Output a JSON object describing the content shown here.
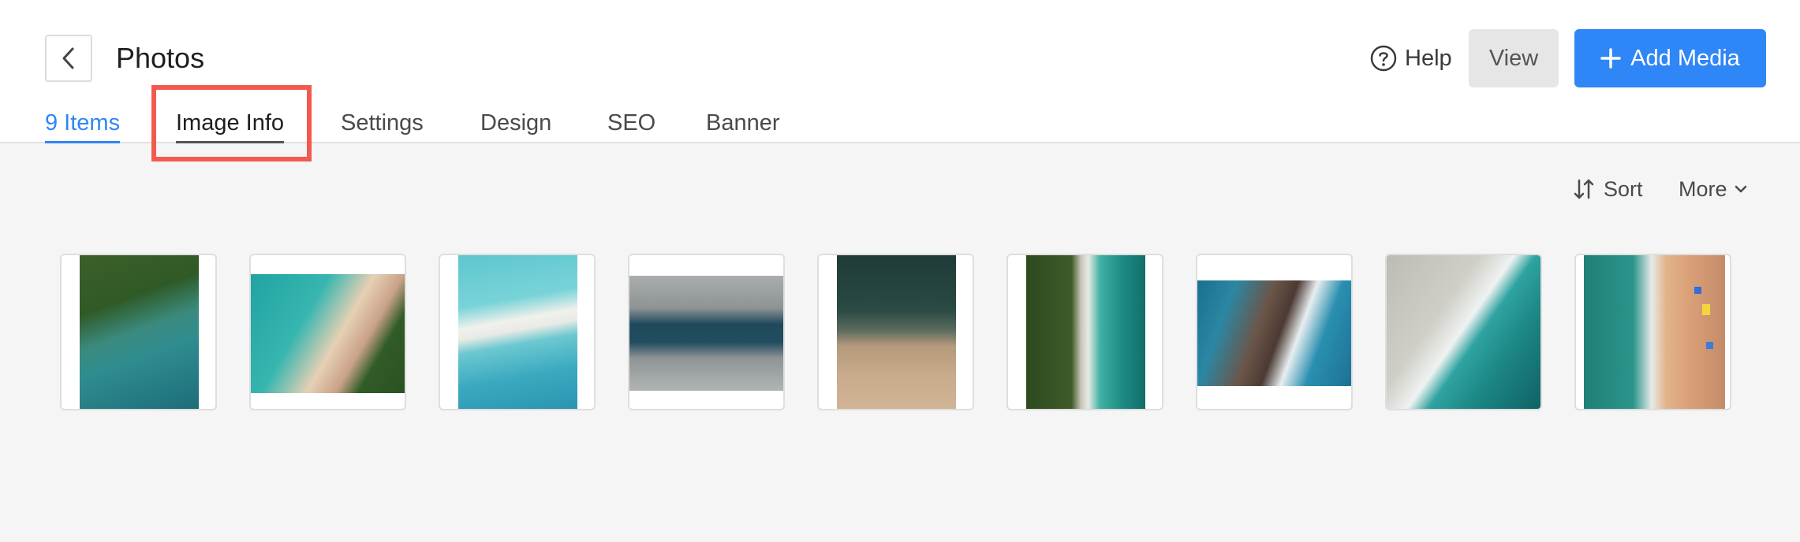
{
  "header": {
    "title": "Photos",
    "help_label": "Help",
    "view_label": "View",
    "add_media_label": "Add Media"
  },
  "tabs": [
    {
      "label": "9 Items",
      "active": true
    },
    {
      "label": "Image Info",
      "highlighted": true
    },
    {
      "label": "Settings"
    },
    {
      "label": "Design"
    },
    {
      "label": "SEO"
    },
    {
      "label": "Banner"
    }
  ],
  "toolbar": {
    "sort_label": "Sort",
    "more_label": "More"
  },
  "colors": {
    "accent": "#2f86f6",
    "highlight_box": "#f25a50",
    "background": "#f5f5f5"
  },
  "icons": [
    "back-arrow-icon",
    "help-circle-icon",
    "plus-icon",
    "sort-arrows-icon",
    "chevron-down-icon"
  ],
  "gallery": {
    "count": 9,
    "photos": [
      {
        "subject": "aerial forest coastline with turquoise water",
        "orientation": "portrait"
      },
      {
        "subject": "aerial beach curve with turquoise sea and trees",
        "orientation": "landscape"
      },
      {
        "subject": "aerial white sandbar in turquoise water",
        "orientation": "portrait"
      },
      {
        "subject": "aerial city canal with buildings",
        "orientation": "landscape"
      },
      {
        "subject": "aerial sandy beach with dark green water",
        "orientation": "portrait"
      },
      {
        "subject": "aerial forest beach with waves",
        "orientation": "portrait"
      },
      {
        "subject": "aerial rocky coast with ocean waves",
        "orientation": "landscape"
      },
      {
        "subject": "aerial white sand beach with teal waves",
        "orientation": "square"
      },
      {
        "subject": "aerial crowded beach with umbrellas",
        "orientation": "portrait"
      }
    ]
  }
}
